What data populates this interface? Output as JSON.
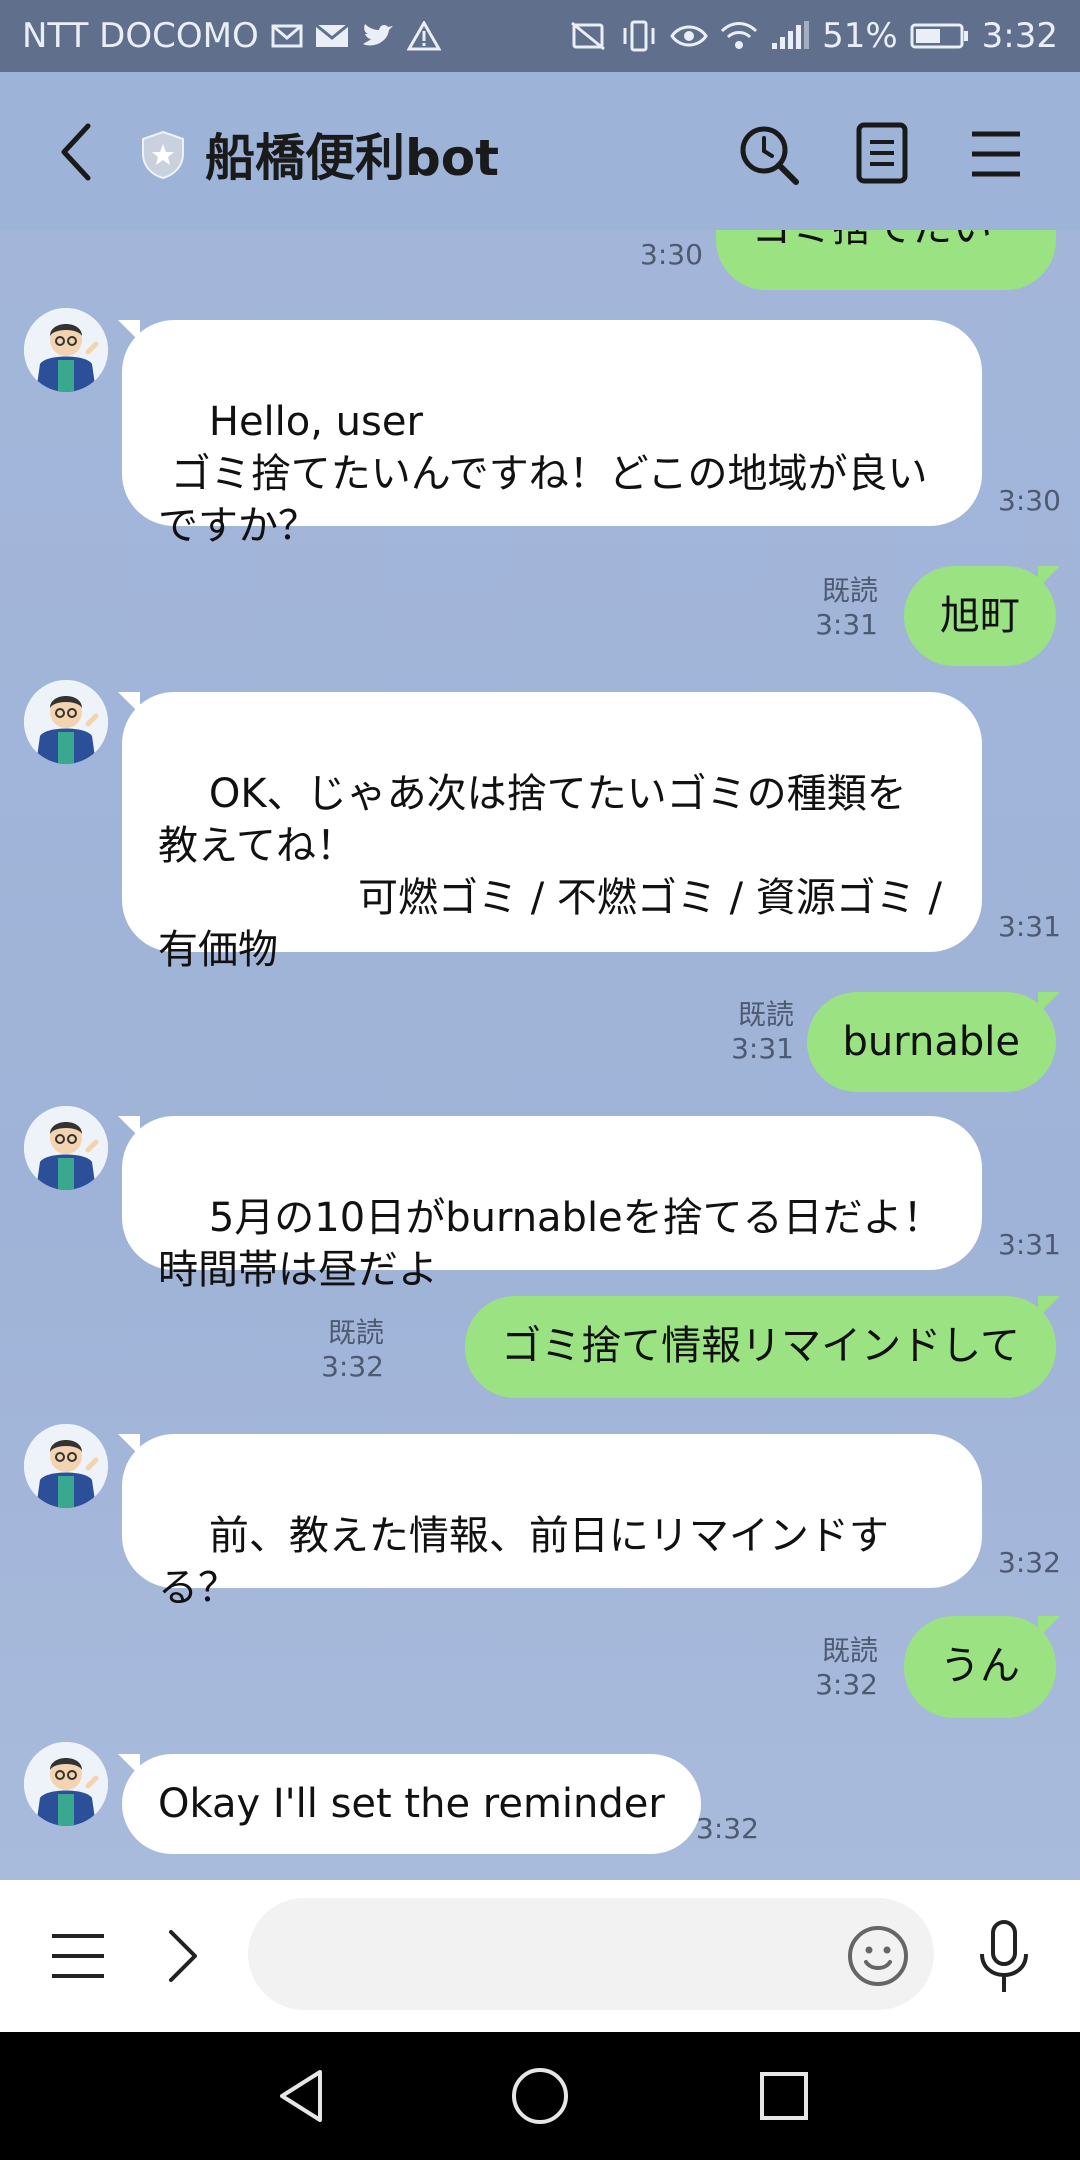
{
  "status_bar": {
    "carrier": "NTT DOCOMO",
    "battery": "51%",
    "time": "3:32"
  },
  "header": {
    "title": "船橋便利bot"
  },
  "messages": [
    {
      "side": "out",
      "text": "ゴミ捨てたい",
      "time": "3:30"
    },
    {
      "side": "in",
      "text": "Hello, user\n ゴミ捨てたいんですね！どこの地域が良いですか？",
      "time": "3:30"
    },
    {
      "side": "out",
      "text": "旭町",
      "read": "既読",
      "time": "3:31"
    },
    {
      "side": "in",
      "text": "OK、じゃあ次は捨てたいゴミの種類を教えてね！\n　　　　　可燃ゴミ / 不燃ゴミ / 資源ゴミ / 有価物",
      "time": "3:31"
    },
    {
      "side": "out",
      "text": "burnable",
      "read": "既読",
      "time": "3:31"
    },
    {
      "side": "in",
      "text": "5月の10日がburnableを捨てる日だよ！\n時間帯は昼だよ",
      "time": "3:31"
    },
    {
      "side": "out",
      "text": "ゴミ捨て情報リマインドして",
      "read": "既読",
      "time": "3:32"
    },
    {
      "side": "in",
      "text": "前、教えた情報、前日にリマインドする？",
      "time": "3:32"
    },
    {
      "side": "out",
      "text": "うん",
      "read": "既読",
      "time": "3:32"
    },
    {
      "side": "in",
      "text": "Okay I'll set the reminder",
      "time": "3:32"
    }
  ],
  "input": {
    "value": "",
    "placeholder": ""
  },
  "colors": {
    "chat_bg": "#9eb3d8",
    "outgoing_bubble": "#9be283",
    "incoming_bubble": "#ffffff",
    "status_bar_bg": "#5f6f8c"
  },
  "icons": {
    "header": [
      "back-arrow-icon",
      "shield-icon",
      "search-clock-icon",
      "note-icon",
      "menu-icon"
    ],
    "input_bar": [
      "menu-icon",
      "chevron-right-icon",
      "emoji-icon",
      "microphone-icon"
    ],
    "nav_bar": [
      "nav-back-icon",
      "nav-home-icon",
      "nav-recent-icon"
    ]
  }
}
